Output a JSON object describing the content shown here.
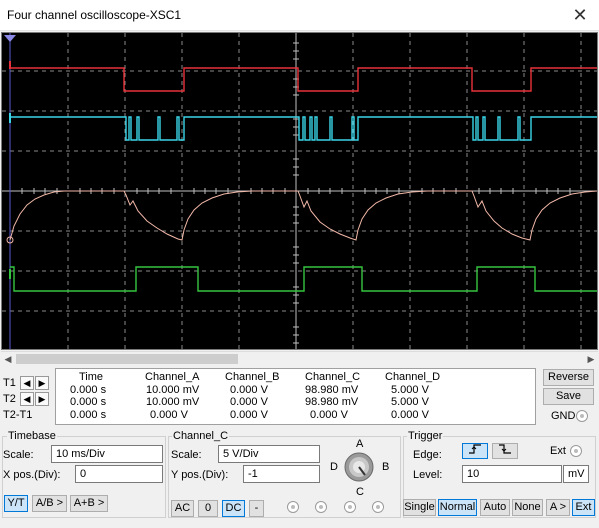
{
  "window": {
    "title": "Four channel oscilloscope-XSC1",
    "close_glyph": "✕"
  },
  "screen": {
    "background": "#000000",
    "grid_color": "#8a8a8a",
    "channel_colors": {
      "A": "#e8323a",
      "B": "#3ad6e8",
      "C": "#f2b8a8",
      "D": "#35c63f"
    }
  },
  "cursor_rows": [
    {
      "label": "T1"
    },
    {
      "label": "T2"
    },
    {
      "label": "T2-T1"
    }
  ],
  "readout": {
    "headers": [
      "Time",
      "Channel_A",
      "Channel_B",
      "Channel_C",
      "Channel_D"
    ],
    "rows": [
      [
        "0.000 s",
        "10.000 mV",
        "0.000 V",
        "98.980 mV",
        "5.000 V"
      ],
      [
        "0.000 s",
        "10.000 mV",
        "0.000 V",
        "98.980 mV",
        "5.000 V"
      ],
      [
        "0.000 s",
        "0.000 V",
        "0.000 V",
        "0.000 V",
        "0.000 V"
      ]
    ]
  },
  "side_buttons": {
    "reverse": "Reverse",
    "save": "Save",
    "gnd": "GND"
  },
  "timebase": {
    "group_label": "Timebase",
    "scale_label": "Scale:",
    "scale_value": "10 ms/Div",
    "xpos_label": "X pos.(Div):",
    "xpos_value": "0",
    "buttons": [
      "Y/T",
      "A/B >",
      "A+B >"
    ]
  },
  "channel": {
    "group_label": "Channel_C",
    "scale_label": "Scale:",
    "scale_value": "5  V/Div",
    "ypos_label": "Y pos.(Div):",
    "ypos_value": "-1",
    "buttons": [
      "AC",
      "0",
      "DC",
      "-"
    ],
    "knob_labels": {
      "A": "A",
      "B": "B",
      "C": "C",
      "D": "D"
    }
  },
  "trigger": {
    "group_label": "Trigger",
    "edge_label": "Edge:",
    "edge_icons": [
      "rising-edge-icon",
      "falling-edge-icon"
    ],
    "ext_label": "Ext",
    "level_label": "Level:",
    "level_value": "10",
    "level_unit": "mV",
    "buttons": [
      "Single",
      "Normal",
      "Auto",
      "None",
      "A >",
      "Ext"
    ]
  }
}
